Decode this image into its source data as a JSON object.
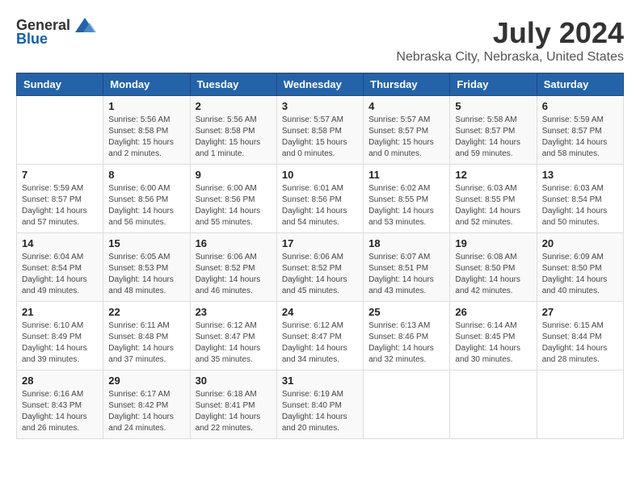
{
  "logo": {
    "general": "General",
    "blue": "Blue"
  },
  "title": "July 2024",
  "location": "Nebraska City, Nebraska, United States",
  "days_of_week": [
    "Sunday",
    "Monday",
    "Tuesday",
    "Wednesday",
    "Thursday",
    "Friday",
    "Saturday"
  ],
  "weeks": [
    [
      {
        "day": "",
        "sunrise": "",
        "sunset": "",
        "daylight": ""
      },
      {
        "day": "1",
        "sunrise": "Sunrise: 5:56 AM",
        "sunset": "Sunset: 8:58 PM",
        "daylight": "Daylight: 15 hours and 2 minutes."
      },
      {
        "day": "2",
        "sunrise": "Sunrise: 5:56 AM",
        "sunset": "Sunset: 8:58 PM",
        "daylight": "Daylight: 15 hours and 1 minute."
      },
      {
        "day": "3",
        "sunrise": "Sunrise: 5:57 AM",
        "sunset": "Sunset: 8:58 PM",
        "daylight": "Daylight: 15 hours and 0 minutes."
      },
      {
        "day": "4",
        "sunrise": "Sunrise: 5:57 AM",
        "sunset": "Sunset: 8:57 PM",
        "daylight": "Daylight: 15 hours and 0 minutes."
      },
      {
        "day": "5",
        "sunrise": "Sunrise: 5:58 AM",
        "sunset": "Sunset: 8:57 PM",
        "daylight": "Daylight: 14 hours and 59 minutes."
      },
      {
        "day": "6",
        "sunrise": "Sunrise: 5:59 AM",
        "sunset": "Sunset: 8:57 PM",
        "daylight": "Daylight: 14 hours and 58 minutes."
      }
    ],
    [
      {
        "day": "7",
        "sunrise": "Sunrise: 5:59 AM",
        "sunset": "Sunset: 8:57 PM",
        "daylight": "Daylight: 14 hours and 57 minutes."
      },
      {
        "day": "8",
        "sunrise": "Sunrise: 6:00 AM",
        "sunset": "Sunset: 8:56 PM",
        "daylight": "Daylight: 14 hours and 56 minutes."
      },
      {
        "day": "9",
        "sunrise": "Sunrise: 6:00 AM",
        "sunset": "Sunset: 8:56 PM",
        "daylight": "Daylight: 14 hours and 55 minutes."
      },
      {
        "day": "10",
        "sunrise": "Sunrise: 6:01 AM",
        "sunset": "Sunset: 8:56 PM",
        "daylight": "Daylight: 14 hours and 54 minutes."
      },
      {
        "day": "11",
        "sunrise": "Sunrise: 6:02 AM",
        "sunset": "Sunset: 8:55 PM",
        "daylight": "Daylight: 14 hours and 53 minutes."
      },
      {
        "day": "12",
        "sunrise": "Sunrise: 6:03 AM",
        "sunset": "Sunset: 8:55 PM",
        "daylight": "Daylight: 14 hours and 52 minutes."
      },
      {
        "day": "13",
        "sunrise": "Sunrise: 6:03 AM",
        "sunset": "Sunset: 8:54 PM",
        "daylight": "Daylight: 14 hours and 50 minutes."
      }
    ],
    [
      {
        "day": "14",
        "sunrise": "Sunrise: 6:04 AM",
        "sunset": "Sunset: 8:54 PM",
        "daylight": "Daylight: 14 hours and 49 minutes."
      },
      {
        "day": "15",
        "sunrise": "Sunrise: 6:05 AM",
        "sunset": "Sunset: 8:53 PM",
        "daylight": "Daylight: 14 hours and 48 minutes."
      },
      {
        "day": "16",
        "sunrise": "Sunrise: 6:06 AM",
        "sunset": "Sunset: 8:52 PM",
        "daylight": "Daylight: 14 hours and 46 minutes."
      },
      {
        "day": "17",
        "sunrise": "Sunrise: 6:06 AM",
        "sunset": "Sunset: 8:52 PM",
        "daylight": "Daylight: 14 hours and 45 minutes."
      },
      {
        "day": "18",
        "sunrise": "Sunrise: 6:07 AM",
        "sunset": "Sunset: 8:51 PM",
        "daylight": "Daylight: 14 hours and 43 minutes."
      },
      {
        "day": "19",
        "sunrise": "Sunrise: 6:08 AM",
        "sunset": "Sunset: 8:50 PM",
        "daylight": "Daylight: 14 hours and 42 minutes."
      },
      {
        "day": "20",
        "sunrise": "Sunrise: 6:09 AM",
        "sunset": "Sunset: 8:50 PM",
        "daylight": "Daylight: 14 hours and 40 minutes."
      }
    ],
    [
      {
        "day": "21",
        "sunrise": "Sunrise: 6:10 AM",
        "sunset": "Sunset: 8:49 PM",
        "daylight": "Daylight: 14 hours and 39 minutes."
      },
      {
        "day": "22",
        "sunrise": "Sunrise: 6:11 AM",
        "sunset": "Sunset: 8:48 PM",
        "daylight": "Daylight: 14 hours and 37 minutes."
      },
      {
        "day": "23",
        "sunrise": "Sunrise: 6:12 AM",
        "sunset": "Sunset: 8:47 PM",
        "daylight": "Daylight: 14 hours and 35 minutes."
      },
      {
        "day": "24",
        "sunrise": "Sunrise: 6:12 AM",
        "sunset": "Sunset: 8:47 PM",
        "daylight": "Daylight: 14 hours and 34 minutes."
      },
      {
        "day": "25",
        "sunrise": "Sunrise: 6:13 AM",
        "sunset": "Sunset: 8:46 PM",
        "daylight": "Daylight: 14 hours and 32 minutes."
      },
      {
        "day": "26",
        "sunrise": "Sunrise: 6:14 AM",
        "sunset": "Sunset: 8:45 PM",
        "daylight": "Daylight: 14 hours and 30 minutes."
      },
      {
        "day": "27",
        "sunrise": "Sunrise: 6:15 AM",
        "sunset": "Sunset: 8:44 PM",
        "daylight": "Daylight: 14 hours and 28 minutes."
      }
    ],
    [
      {
        "day": "28",
        "sunrise": "Sunrise: 6:16 AM",
        "sunset": "Sunset: 8:43 PM",
        "daylight": "Daylight: 14 hours and 26 minutes."
      },
      {
        "day": "29",
        "sunrise": "Sunrise: 6:17 AM",
        "sunset": "Sunset: 8:42 PM",
        "daylight": "Daylight: 14 hours and 24 minutes."
      },
      {
        "day": "30",
        "sunrise": "Sunrise: 6:18 AM",
        "sunset": "Sunset: 8:41 PM",
        "daylight": "Daylight: 14 hours and 22 minutes."
      },
      {
        "day": "31",
        "sunrise": "Sunrise: 6:19 AM",
        "sunset": "Sunset: 8:40 PM",
        "daylight": "Daylight: 14 hours and 20 minutes."
      },
      {
        "day": "",
        "sunrise": "",
        "sunset": "",
        "daylight": ""
      },
      {
        "day": "",
        "sunrise": "",
        "sunset": "",
        "daylight": ""
      },
      {
        "day": "",
        "sunrise": "",
        "sunset": "",
        "daylight": ""
      }
    ]
  ]
}
